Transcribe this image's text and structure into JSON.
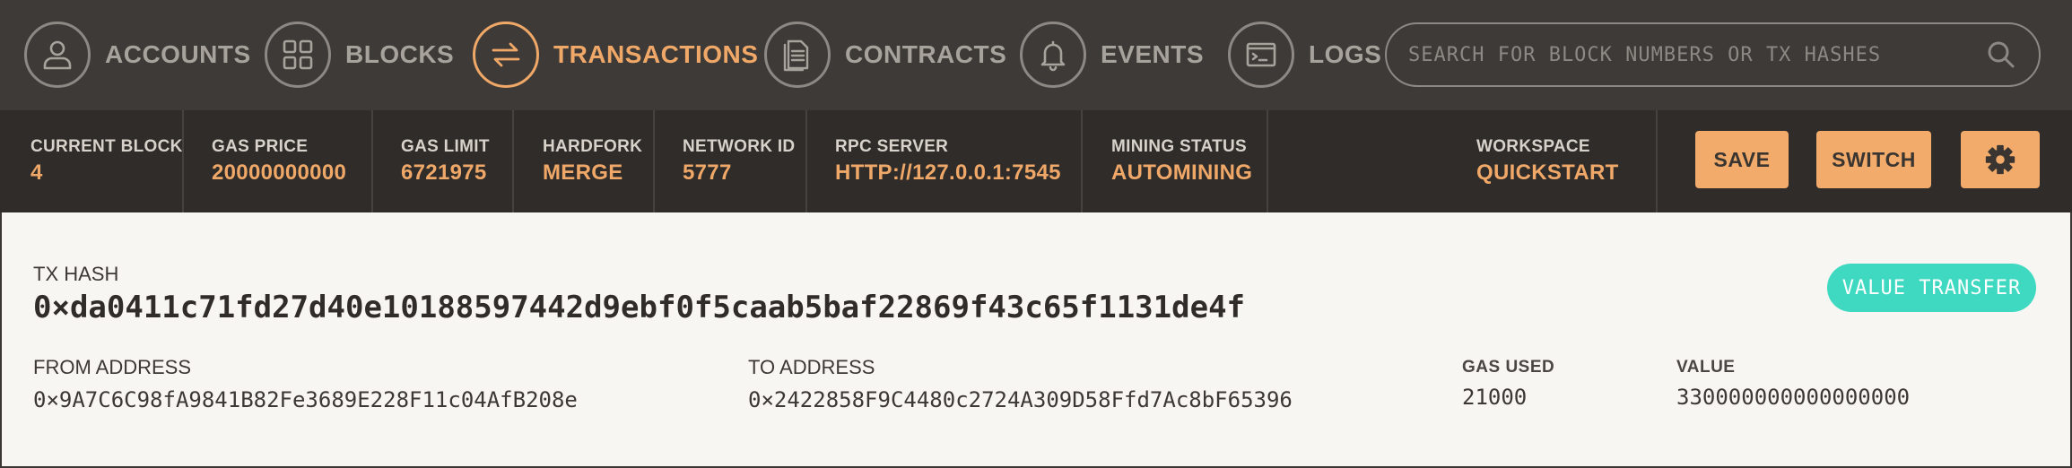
{
  "nav": {
    "items": [
      {
        "label": "ACCOUNTS",
        "icon": "user-icon"
      },
      {
        "label": "BLOCKS",
        "icon": "grid-icon"
      },
      {
        "label": "TRANSACTIONS",
        "icon": "swap-arrows-icon",
        "active": true
      },
      {
        "label": "CONTRACTS",
        "icon": "document-icon"
      },
      {
        "label": "EVENTS",
        "icon": "bell-icon"
      },
      {
        "label": "LOGS",
        "icon": "terminal-icon"
      }
    ],
    "search_placeholder": "SEARCH FOR BLOCK NUMBERS OR TX HASHES"
  },
  "status": {
    "current_block": {
      "label": "CURRENT BLOCK",
      "value": "4"
    },
    "gas_price": {
      "label": "GAS PRICE",
      "value": "20000000000"
    },
    "gas_limit": {
      "label": "GAS LIMIT",
      "value": "6721975"
    },
    "hardfork": {
      "label": "HARDFORK",
      "value": "MERGE"
    },
    "network_id": {
      "label": "NETWORK ID",
      "value": "5777"
    },
    "rpc_server": {
      "label": "RPC SERVER",
      "value": "HTTP://127.0.0.1:7545"
    },
    "mining_status": {
      "label": "MINING STATUS",
      "value": "AUTOMINING"
    },
    "workspace": {
      "label": "WORKSPACE",
      "value": "QUICKSTART"
    },
    "save_label": "SAVE",
    "switch_label": "SWITCH"
  },
  "tx": {
    "hash_label": "TX HASH",
    "hash": "0×da0411c71fd27d40e10188597442d9ebf0f5caab5baf22869f43c65f1131de4f",
    "type_badge": "VALUE TRANSFER",
    "from_label": "FROM ADDRESS",
    "from": "0×9A7C6C98fA9841B82Fe3689E228F11c04AfB208e",
    "to_label": "TO ADDRESS",
    "to": "0×2422858F9C4480c2724A309D58Ffd7Ac8bF65396",
    "gas_used_label": "GAS USED",
    "gas_used": "21000",
    "value_label": "VALUE",
    "value": "330000000000000000"
  },
  "colors": {
    "accent": "#f0a868",
    "nav_bg": "#3e3a37",
    "status_bg": "#2f2c2a",
    "panel_bg": "#f8f6f2",
    "badge": "#3ed9c0"
  }
}
